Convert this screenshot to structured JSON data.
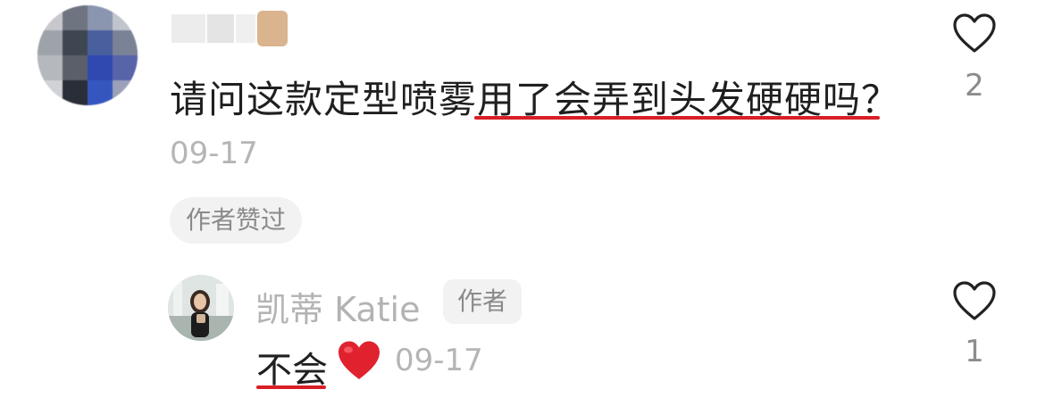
{
  "comment": {
    "avatar": "blurred-avatar",
    "text": "请问这款定型喷雾用了会弄到头发硬硬吗？",
    "date": "09-17",
    "liked_badge": "作者赞过",
    "like_count": "2"
  },
  "reply": {
    "author": "凯蒂 Katie",
    "author_badge": "作者",
    "text": "不会",
    "emoji": "red-heart-emoji",
    "date": "09-17",
    "like_count": "1"
  },
  "colors": {
    "underline": "#d81f26",
    "heart_emoji": "#e0222f"
  }
}
